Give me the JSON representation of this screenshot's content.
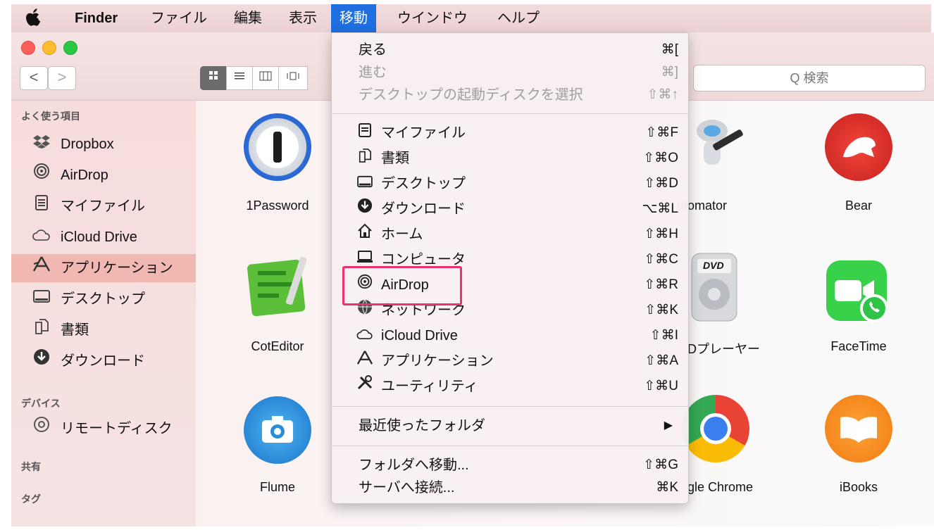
{
  "menubar": {
    "apple": "",
    "app": "Finder",
    "items": [
      "ファイル",
      "編集",
      "表示",
      "移動",
      "ウインドウ",
      "ヘルプ"
    ],
    "active": "移動"
  },
  "toolbar": {
    "back": "<",
    "forward": ">",
    "search_placeholder": "Q 検索"
  },
  "sidebar": {
    "favorites_header": "よく使う項目",
    "favorites": [
      {
        "icon": "dropbox-icon",
        "label": "Dropbox"
      },
      {
        "icon": "airdrop-icon",
        "label": "AirDrop"
      },
      {
        "icon": "myfiles-icon",
        "label": "マイファイル"
      },
      {
        "icon": "cloud-icon",
        "label": "iCloud Drive"
      },
      {
        "icon": "applications-icon",
        "label": "アプリケーション",
        "selected": true
      },
      {
        "icon": "desktop-icon",
        "label": "デスクトップ"
      },
      {
        "icon": "documents-icon",
        "label": "書類"
      },
      {
        "icon": "downloads-icon",
        "label": "ダウンロード"
      }
    ],
    "devices_header": "デバイス",
    "devices": [
      {
        "icon": "disc-icon",
        "label": "リモートディスク"
      }
    ],
    "shared_header": "共有",
    "tags_header": "タグ"
  },
  "apps": {
    "onepassword": "1Password",
    "automator": "utomator",
    "bear": "Bear",
    "coteditor": "CotEditor",
    "dvd": "Dプレーヤー",
    "facetime": "FaceTime",
    "flume": "Flume",
    "chrome": "gle Chrome",
    "ibooks": "iBooks",
    "dvd_badge": "DVD"
  },
  "menu": {
    "back": {
      "label": "戻る",
      "shortcut": "⌘["
    },
    "forward": {
      "label": "進む",
      "shortcut": "⌘]"
    },
    "startup": {
      "label": "デスクトップの起動ディスクを選択",
      "shortcut": "⇧⌘↑"
    },
    "items": [
      {
        "icon": "myfiles-icon",
        "label": "マイファイル",
        "shortcut": "⇧⌘F"
      },
      {
        "icon": "documents-icon",
        "label": "書類",
        "shortcut": "⇧⌘O"
      },
      {
        "icon": "desktop-icon",
        "label": "デスクトップ",
        "shortcut": "⇧⌘D"
      },
      {
        "icon": "downloads-icon",
        "label": "ダウンロード",
        "shortcut": "⌥⌘L"
      },
      {
        "icon": "home-icon",
        "label": "ホーム",
        "shortcut": "⇧⌘H"
      },
      {
        "icon": "computer-icon",
        "label": "コンピュータ",
        "shortcut": "⇧⌘C"
      },
      {
        "icon": "airdrop-icon",
        "label": "AirDrop",
        "shortcut": "⇧⌘R"
      },
      {
        "icon": "network-icon",
        "label": "ネットワーク",
        "shortcut": "⇧⌘K"
      },
      {
        "icon": "cloud-icon",
        "label": "iCloud Drive",
        "shortcut": "⇧⌘I"
      },
      {
        "icon": "applications-icon",
        "label": "アプリケーション",
        "shortcut": "⇧⌘A"
      },
      {
        "icon": "utilities-icon",
        "label": "ユーティリティ",
        "shortcut": "⇧⌘U"
      }
    ],
    "recent": {
      "label": "最近使ったフォルダ",
      "shortcut": "▶"
    },
    "goto_folder": {
      "label": "フォルダへ移動...",
      "shortcut": "⇧⌘G"
    },
    "connect_server": {
      "label": "サーバへ接続...",
      "shortcut": "⌘K"
    }
  },
  "colors": {
    "accent": "#1f6fe0",
    "highlight_box": "#e8336c",
    "sidebar_selected": "#f1b7b1"
  }
}
